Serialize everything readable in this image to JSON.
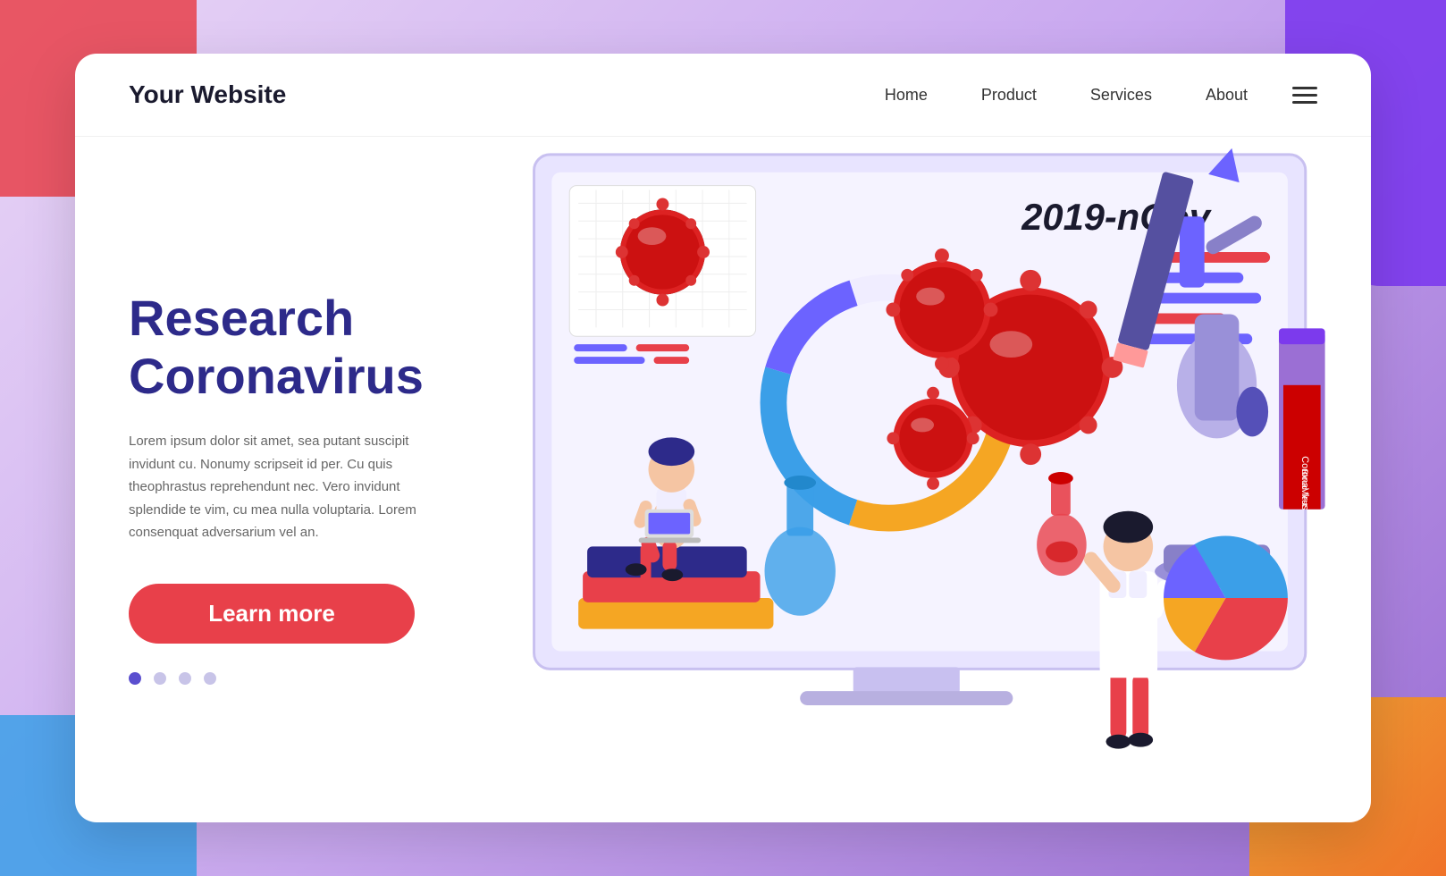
{
  "logo": "Your Website",
  "nav": {
    "links": [
      {
        "label": "Home",
        "id": "home"
      },
      {
        "label": "Product",
        "id": "product"
      },
      {
        "label": "Services",
        "id": "services"
      },
      {
        "label": "About",
        "id": "about"
      }
    ]
  },
  "hero": {
    "headline_line1": "Research",
    "headline_line2": "Coronavirus",
    "description": "Lorem ipsum dolor sit amet, sea putant suscipit invidunt cu. Nonumy scripseit id per. Cu quis theophrastus reprehendunt nec. Vero invidunt splendide te vim, cu mea nulla voluptaria. Lorem consenquat adversarium vel an.",
    "cta_label": "Learn more",
    "ncov_label": "2019-nCov",
    "dots": [
      {
        "active": true
      },
      {
        "active": false
      },
      {
        "active": false
      },
      {
        "active": false
      }
    ]
  },
  "colors": {
    "primary_purple": "#2d2a8a",
    "cta_red": "#e8404a",
    "accent_blue": "#3b9fe8",
    "accent_orange": "#f5a623",
    "virus_red": "#cc0000"
  },
  "icons": {
    "hamburger": "≡"
  }
}
